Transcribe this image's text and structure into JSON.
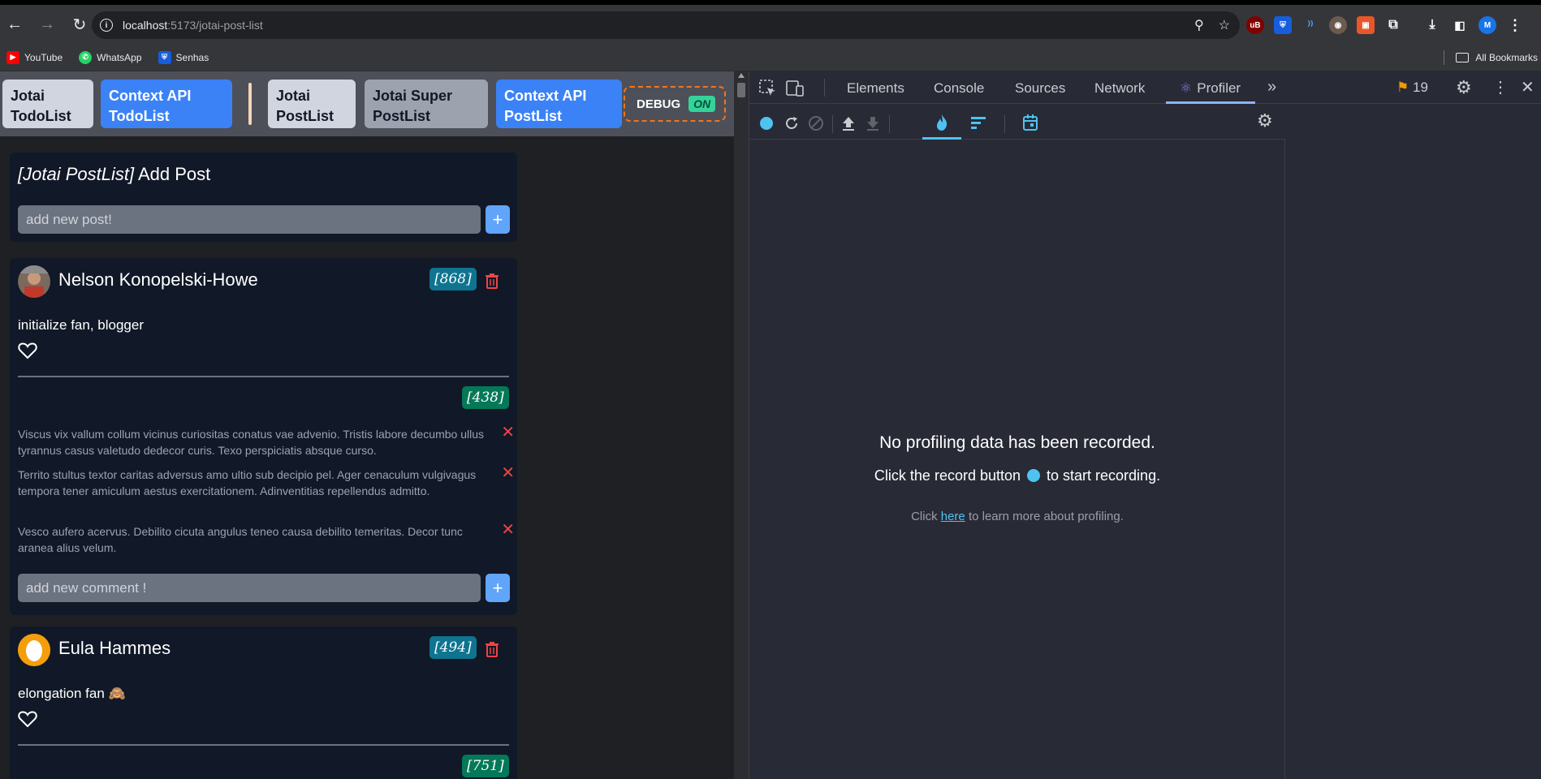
{
  "browser": {
    "url_host": "localhost",
    "url_path": ":5173/jotai-post-list",
    "bookmarks": [
      {
        "label": "YouTube",
        "color": "#ff0000"
      },
      {
        "label": "WhatsApp",
        "color": "#25d366"
      },
      {
        "label": "Senhas",
        "color": "#175ddc"
      }
    ],
    "all_bookmarks": "All Bookmarks",
    "profile_initial": "M"
  },
  "nav": {
    "jotai_todo": "Jotai TodoList",
    "ctx_todo": "Context API TodoList",
    "jotai_post": "Jotai PostList",
    "jotai_super_post": "Jotai Super PostList",
    "ctx_post": "Context API PostList",
    "debug_label": "DEBUG",
    "debug_state": "ON"
  },
  "add_post": {
    "title_prefix": "[Jotai PostList]",
    "title_rest": " Add Post",
    "placeholder": "add new post!",
    "plus": "+"
  },
  "posts": [
    {
      "author": "Nelson Konopelski-Howe",
      "badge": "[868]",
      "text": "initialize fan, blogger",
      "comments_badge": "[438]",
      "comments": [
        "Viscus vix vallum collum vicinus curiositas conatus vae advenio. Tristis labore decumbo ullus tyrannus casus valetudo dedecor curis. Texo perspiciatis absque curso.",
        "Territo stultus textor caritas adversus amo ultio sub decipio pel. Ager cenaculum vulgivagus tempora tener amiculum aestus exercitationem. Adinventitias repellendus admitto.",
        "Vesco aufero acervus. Debilito cicuta angulus teneo causa debilito temeritas. Decor tunc aranea alius velum."
      ],
      "comment_placeholder": "add new comment !"
    },
    {
      "author": "Eula Hammes",
      "badge": "[494]",
      "text": "elongation fan",
      "emoji": "🙈",
      "comments_badge": "[751]"
    }
  ],
  "devtools": {
    "tabs": [
      "Elements",
      "Console",
      "Sources",
      "Network",
      "Profiler"
    ],
    "issues_count": "19",
    "empty_title": "No profiling data has been recorded.",
    "empty_sub_before": "Click the record button",
    "empty_sub_after": "to start recording.",
    "help_before": "Click ",
    "help_link": "here",
    "help_after": " to learn more about profiling."
  }
}
